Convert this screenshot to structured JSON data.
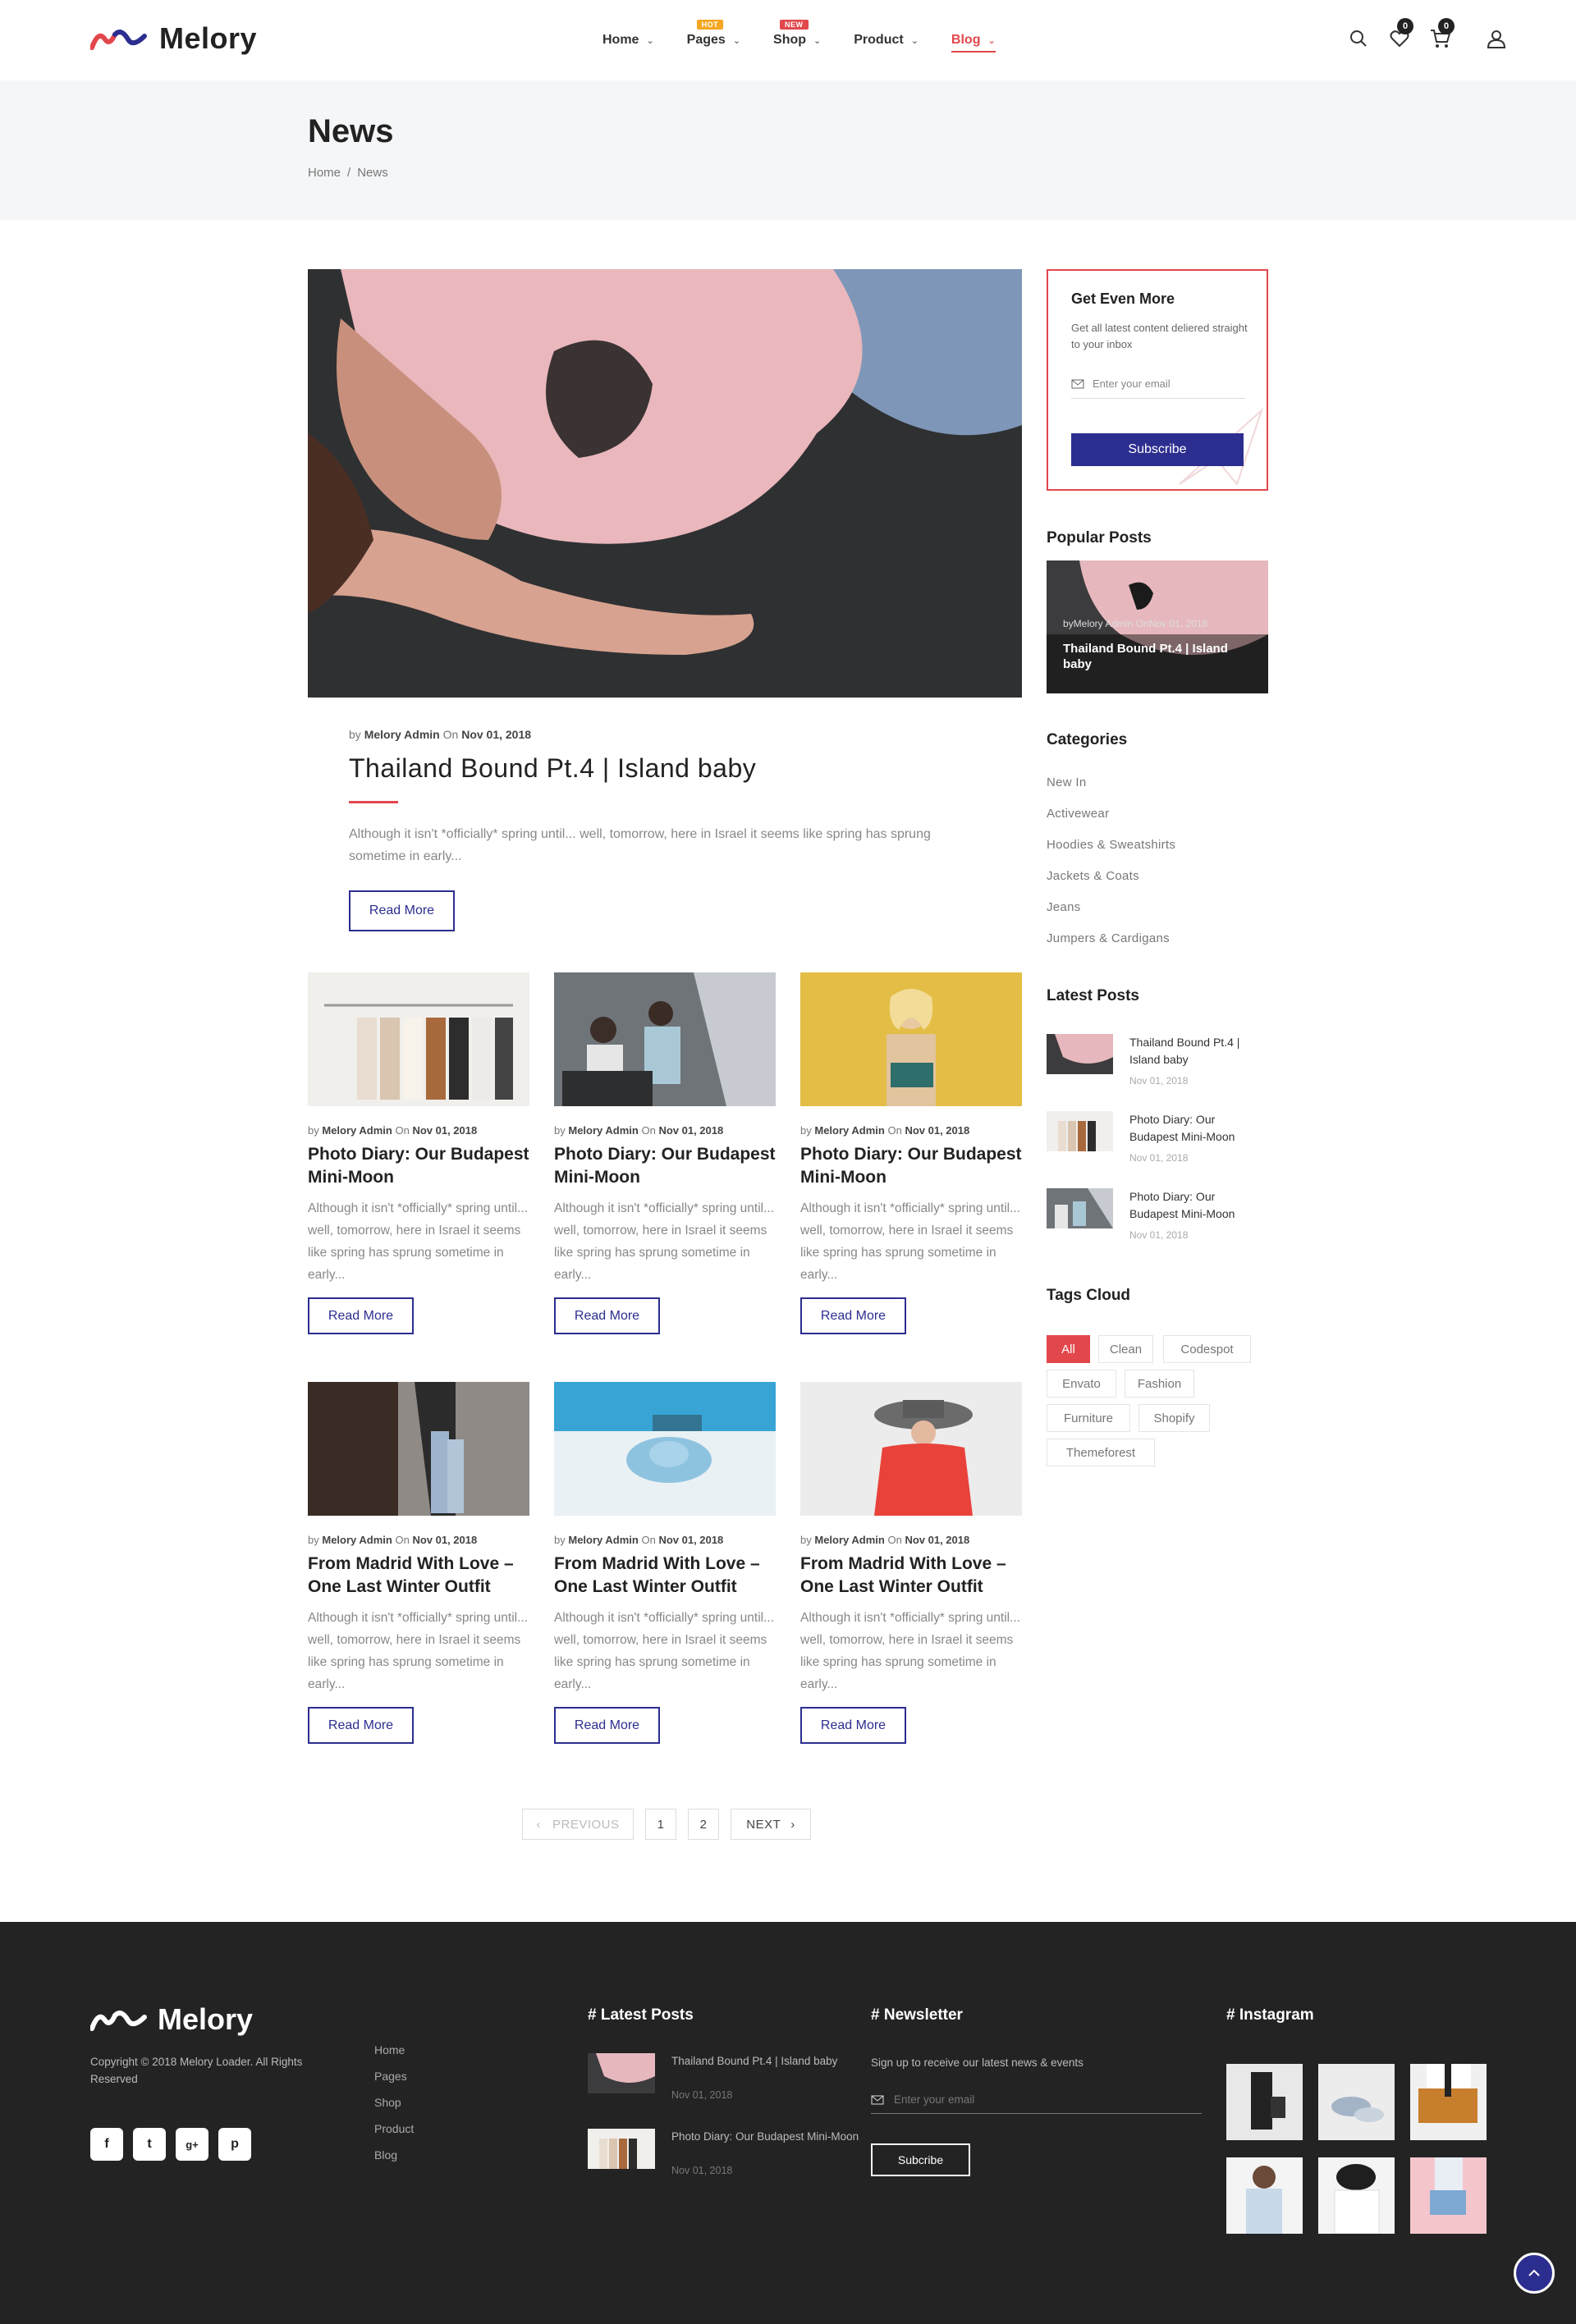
{
  "header": {
    "brand": "Melory",
    "nav": [
      {
        "label": "Home",
        "badge": ""
      },
      {
        "label": "Pages",
        "badge": "HOT"
      },
      {
        "label": "Shop",
        "badge": "NEW"
      },
      {
        "label": "Product",
        "badge": ""
      },
      {
        "label": "Blog",
        "badge": ""
      }
    ],
    "wishlist_count": "0",
    "cart_count": "0",
    "colors": {
      "accent": "#e2474c",
      "primary": "#2c2e8f",
      "hot_badge": "#f5a623",
      "new_badge": "#e2474c"
    },
    "icons": [
      "search-icon",
      "heart-icon",
      "cart-icon",
      "user-icon"
    ]
  },
  "banner": {
    "title": "News",
    "breadcrumb": [
      "Home",
      "/",
      "News"
    ]
  },
  "featured": {
    "by": "by",
    "author": "Melory Admin",
    "on": "On",
    "date": "Nov 01, 2018",
    "title": "Thailand Bound Pt.4 | Island baby",
    "excerpt": "Although it isn't *officially* spring until... well, tomorrow, here in Israel it seems like spring has sprung sometime in early...",
    "button": "Read More"
  },
  "posts": [
    {
      "by": "by",
      "author": "Melory Admin",
      "on": "On",
      "date": "Nov 01, 2018",
      "title": "Photo Diary: Our Budapest Mini-Moon",
      "excerpt": "Although it isn't *officially* spring until... well, tomorrow, here in Israel it seems like spring has sprung sometime in early...",
      "button": "Read More"
    },
    {
      "by": "by",
      "author": "Melory Admin",
      "on": "On",
      "date": "Nov 01, 2018",
      "title": "Photo Diary: Our Budapest Mini-Moon",
      "excerpt": "Although it isn't *officially* spring until... well, tomorrow, here in Israel it seems like spring has sprung sometime in early...",
      "button": "Read More"
    },
    {
      "by": "by",
      "author": "Melory Admin",
      "on": "On",
      "date": "Nov 01, 2018",
      "title": "Photo Diary: Our Budapest Mini-Moon",
      "excerpt": "Although it isn't *officially* spring until... well, tomorrow, here in Israel it seems like spring has sprung sometime in early...",
      "button": "Read More"
    },
    {
      "by": "by",
      "author": "Melory Admin",
      "on": "On",
      "date": "Nov 01, 2018",
      "title": "From Madrid With Love – One Last Winter Outfit",
      "excerpt": "Although it isn't *officially* spring until... well, tomorrow, here in Israel it seems like spring has sprung sometime in early...",
      "button": "Read More"
    },
    {
      "by": "by",
      "author": "Melory Admin",
      "on": "On",
      "date": "Nov 01, 2018",
      "title": "From Madrid With Love – One Last Winter Outfit",
      "excerpt": "Although it isn't *officially* spring until... well, tomorrow, here in Israel it seems like spring has sprung sometime in early...",
      "button": "Read More"
    },
    {
      "by": "by",
      "author": "Melory Admin",
      "on": "On",
      "date": "Nov 01, 2018",
      "title": "From Madrid With Love – One Last Winter Outfit",
      "excerpt": "Although it isn't *officially* spring until... well, tomorrow, here in Israel it seems like spring has sprung sometime in early...",
      "button": "Read More"
    }
  ],
  "pagination": {
    "previous": "PREVIOUS",
    "pages": [
      "1",
      "2"
    ],
    "next": "NEXT"
  },
  "sidebar": {
    "newsletter": {
      "title": "Get Even More",
      "desc": "Get all latest content deliered straight to your inbox",
      "placeholder": "Enter your email",
      "button": "Subscribe"
    },
    "popular_title": "Popular Posts",
    "popular": {
      "meta": "byMelory Admin OnNov 01, 2018",
      "title": "Thailand Bound Pt.4 | Island baby"
    },
    "categories_title": "Categories",
    "categories": [
      "New In",
      "Activewear",
      "Hoodies & Sweatshirts",
      "Jackets & Coats",
      "Jeans",
      "Jumpers & Cardigans"
    ],
    "latest_title": "Latest Posts",
    "latest": [
      {
        "title": "Thailand Bound Pt.4 | Island baby",
        "date": "Nov 01, 2018"
      },
      {
        "title": "Photo Diary: Our Budapest Mini-Moon",
        "date": "Nov 01, 2018"
      },
      {
        "title": "Photo Diary: Our Budapest Mini-Moon",
        "date": "Nov 01, 2018"
      }
    ],
    "tags_title": "Tags Cloud",
    "tags": [
      "All",
      "Clean",
      "Codespot",
      "Envato",
      "Fashion",
      "Furniture",
      "Shopify",
      "Themeforest"
    ]
  },
  "footer": {
    "brand": "Melory",
    "copyright": "Copyright © 2018 Melory Loader. All Rights Reserved",
    "social": [
      "f",
      "t",
      "g+",
      "p"
    ],
    "links": [
      "Home",
      "Pages",
      "Shop",
      "Product",
      "Blog"
    ],
    "latest_title": "# Latest Posts",
    "latest": [
      {
        "title": "Thailand Bound Pt.4 | Island baby",
        "date": "Nov 01, 2018"
      },
      {
        "title": "Photo Diary: Our Budapest Mini-Moon",
        "date": "Nov 01, 2018"
      }
    ],
    "newsletter_title": "# Newsletter",
    "newsletter_desc": "Sign up to receive our latest news & events",
    "newsletter_placeholder": "Enter your email",
    "newsletter_button": "Subcribe",
    "instagram_title": "# Instagram"
  }
}
